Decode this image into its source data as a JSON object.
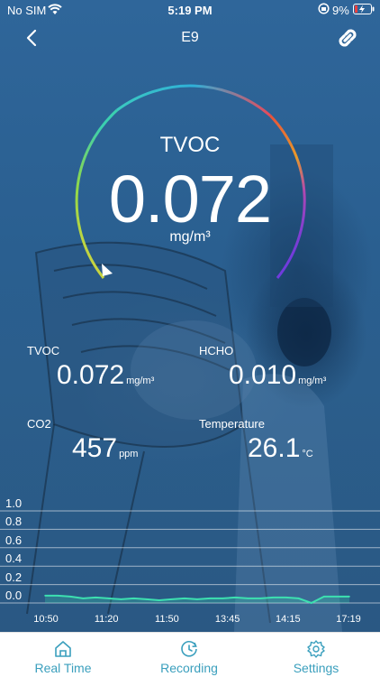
{
  "status_bar": {
    "carrier": "No SIM",
    "time": "5:19 PM",
    "battery": "9%"
  },
  "nav": {
    "title": "E9",
    "back_icon": "chevron-left-icon",
    "link_icon": "link-icon"
  },
  "gauge": {
    "label": "TVOC",
    "value": "0.072",
    "unit": "mg/m³",
    "level": 0.072,
    "gradient": [
      "#e8d23a",
      "#7ad94a",
      "#38c9a0",
      "#2fb0d8",
      "#e84a5a",
      "#e87a2a",
      "#7a3ad8"
    ]
  },
  "readings": {
    "tvoc": {
      "label": "TVOC",
      "value": "0.072",
      "unit": "mg/m³"
    },
    "hcho": {
      "label": "HCHO",
      "value": "0.010",
      "unit": "mg/m³"
    },
    "co2": {
      "label": "CO2",
      "value": "457",
      "unit": "ppm"
    },
    "temperature": {
      "label": "Temperature",
      "value": "26.1",
      "unit": "°C"
    }
  },
  "chart_data": {
    "type": "line",
    "y_ticks": [
      "1.0",
      "0.8",
      "0.6",
      "0.4",
      "0.2",
      "0.0"
    ],
    "ylim": [
      0,
      1.0
    ],
    "x_ticks": [
      "10:50",
      "11:20",
      "11:50",
      "13:45",
      "14:15",
      "17:19"
    ],
    "line_color": "#3de0b0",
    "grid": true,
    "series": [
      {
        "values": [
          0.08,
          0.08,
          0.07,
          0.05,
          0.06,
          0.05,
          0.04,
          0.05,
          0.04,
          0.03,
          0.04,
          0.05,
          0.04,
          0.05,
          0.05,
          0.06,
          0.05,
          0.05,
          0.06,
          0.06,
          0.05,
          0.0,
          0.07,
          0.07,
          0.07
        ]
      }
    ]
  },
  "tabs": [
    {
      "label": "Real Time",
      "icon": "home-icon"
    },
    {
      "label": "Recording",
      "icon": "clock-icon"
    },
    {
      "label": "Settings",
      "icon": "gear-icon"
    }
  ]
}
